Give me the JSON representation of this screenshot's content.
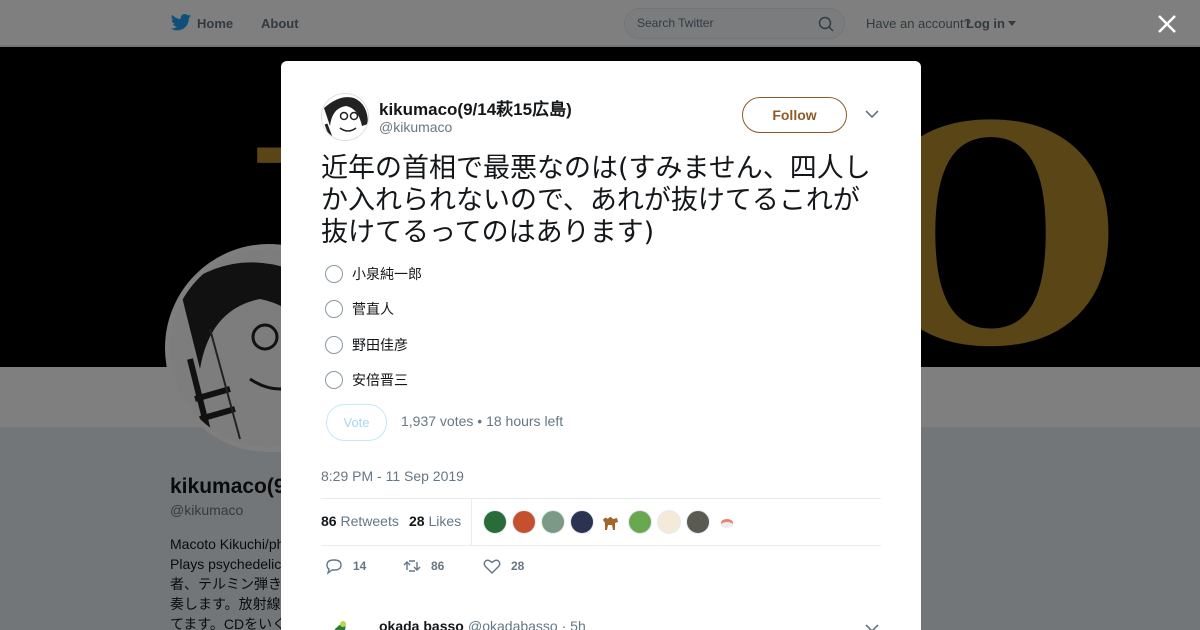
{
  "nav": {
    "home_label": "Home",
    "about_label": "About",
    "search_placeholder": "Search Twitter",
    "have_account": "Have an account?",
    "login_label": "Log in"
  },
  "profile": {
    "name": "kikumaco(9",
    "handle": "@kikumaco",
    "bio": "Macoto Kikuchi/ph Plays psychedelic 者、テルミン弾き 奏します。放射線 てます。CDをいく"
  },
  "tweet": {
    "author_name": "kikumaco(9/14萩15広島)",
    "author_handle": "@kikumaco",
    "follow_label": "Follow",
    "text": "近年の首相で最悪なのは(すみません、四人しか入れられないので、あれが抜けてるこれが抜けてるってのはあります)",
    "poll": {
      "options": [
        "小泉純一郎",
        "菅直人",
        "野田佳彦",
        "安倍晋三"
      ],
      "vote_label": "Vote",
      "meta": "1,937 votes • 18 hours left"
    },
    "timestamp": "8:29 PM - 11 Sep 2019",
    "retweets_count": "86",
    "retweets_label": "Retweets",
    "likes_count": "28",
    "likes_label": "Likes",
    "actions": {
      "reply_count": "14",
      "retweet_count": "86",
      "like_count": "28"
    }
  },
  "reply": {
    "name": "okada basso",
    "handle": "@okadabasso · 5h"
  },
  "colors": {
    "follow_brand": "#8e5a2b",
    "banner_gold": "#b38a2a",
    "twitter_blue": "#1da1f2"
  }
}
